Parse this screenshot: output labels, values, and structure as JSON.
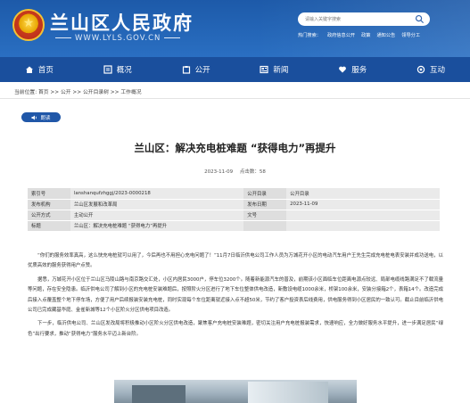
{
  "site": {
    "title": "兰山区人民政府",
    "url": "WWW.LYLS.GOV.CN"
  },
  "search": {
    "placeholder": "请输入关键字搜索"
  },
  "quick_links": [
    "热门搜索：",
    "政府信息公开",
    "政策",
    "通知公告",
    "领导分工"
  ],
  "nav": [
    {
      "label": "首页",
      "icon": "home-icon"
    },
    {
      "label": "概况",
      "icon": "overview-icon"
    },
    {
      "label": "公开",
      "icon": "open-icon"
    },
    {
      "label": "新闻",
      "icon": "news-icon"
    },
    {
      "label": "服务",
      "icon": "service-icon"
    },
    {
      "label": "互动",
      "icon": "interact-icon"
    }
  ],
  "breadcrumb": "当前位置: 首页 >> 公开 >> 公开目录树 >> 工作概况",
  "read_button": "朗读",
  "article": {
    "title": "兰山区：解决充电桩难题 “获得电力”再提升",
    "date": "2023-11-09",
    "views": "点击数：58"
  },
  "info_table": [
    {
      "k1": "索引号",
      "v1": "lanshanqufzhggj/2023-0000218",
      "k2": "公开目录",
      "v2": "公开目录"
    },
    {
      "k1": "发布机构",
      "v1": "兰山区发展和改革局",
      "k2": "发布日期",
      "v2": "2023-11-09"
    },
    {
      "k1": "公开方式",
      "v1": "主动公开",
      "k2": "文号",
      "v2": ""
    },
    {
      "k1": "标题",
      "v1": "兰山区：解决充电桩难题 “获得电力”再提升",
      "k2": "",
      "v2": ""
    }
  ],
  "paragraphs": [
    "“你们的服务效率真高，这么快充电桩就可以用了，今后再也不用担心充电问题了！”11月7日临沂供电公司工作人员为万城花开小区的电动汽车用户王先生完成充电桩电表安装并成功送电，以优质高效的服务获得用户点赞。",
    "据悉，万城花开小区位于兰山区马陵山路与南京路交汇处，小区内居民3000户，停车位3200个。随着新能源汽车的普及，前期该小区面临车位距离电源点较远、局部电缆线路满足不了载流量等问题，存在安全隐患。临沂供电公司了解到小区的充电桩安装难题后，按照阶火分区进行了地下车位整体供电改造，新敷设电缆1000余米，桥架100余米，安装分接箱2个，表箱14个。改造完成后接入点覆盖整个地下停车场，方便了用户后续报装安装充电桩，同时实现每个车位距离就近接入点不超50米，节约了客户投资表后线费用，供电服务得到小区居民的一致认可。截止目前临沂供电公司已完成藏基华庭、金雀新城等12个小区阶火分区供电项目改造。",
    "下一步，临沂供电公司、兰山区发改局将积极推动小区阶火分区供电改造，聚焦客户充电桩安装难题，密切关注用户充电桩报装需求，快速响应，全力做好服务水平提升，进一步满足居民“绿色”出行要求，推动“获得电力”服务水平迈上新台阶。"
  ]
}
